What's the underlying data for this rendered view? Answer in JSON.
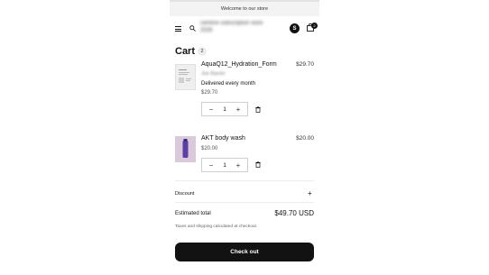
{
  "announcement": "Welcome to our store",
  "header": {
    "store_name": "Dentine subscription store 2026",
    "avatar_letter": "S",
    "bag_count": "2",
    "menu_icon": "hamburger-icon",
    "search_icon": "search-icon",
    "bag_icon": "shopping-bag-icon"
  },
  "cart": {
    "title": "Cart",
    "count": "2",
    "items": [
      {
        "name": "AquaQ12_Hydration_Form",
        "price": "$29.70",
        "blurred_detail": "Joe Barrier",
        "selling_plan": "Delivered every month",
        "unit_price": "$29.70",
        "quantity": "1",
        "thumb_color": "#e9e9e9"
      },
      {
        "name": "AKT body wash",
        "price": "$20.00",
        "unit_price": "$20.00",
        "quantity": "1",
        "thumb_color": "#d8c7d9"
      }
    ],
    "qty_minus": "−",
    "qty_plus": "+",
    "trash_icon": "trash-icon"
  },
  "summary": {
    "discount_label": "Discount",
    "discount_toggle": "+",
    "estimated_label": "Estimated total",
    "estimated_value": "$49.70 USD",
    "taxes_note": "Taxes and shipping calculated at checkout.",
    "checkout_label": "Check out"
  }
}
